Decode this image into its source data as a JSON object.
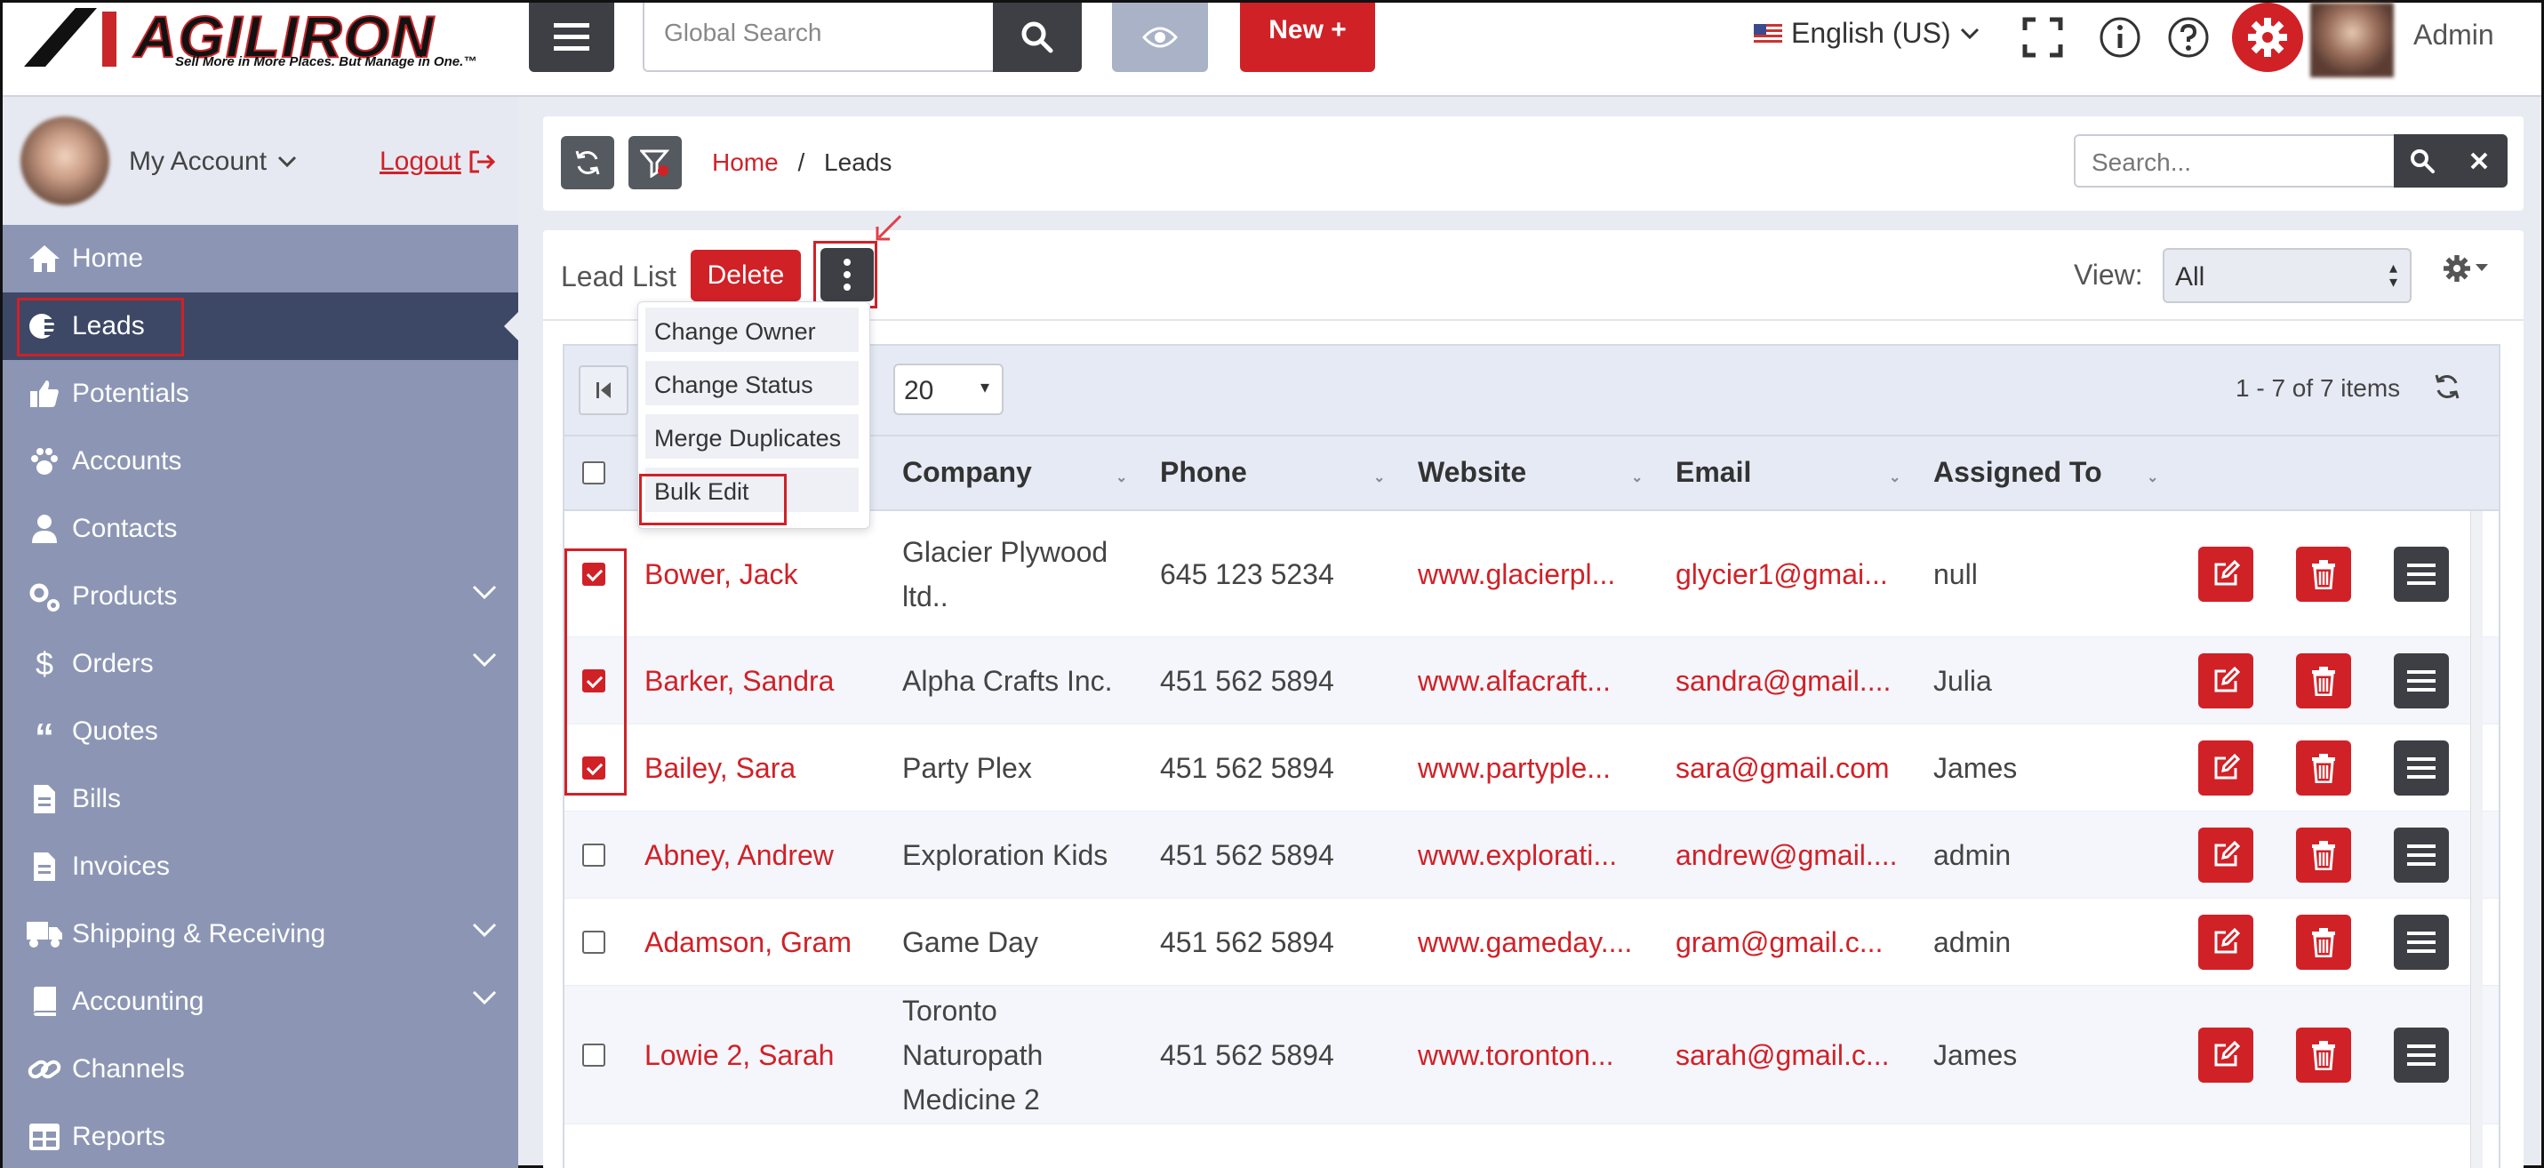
{
  "brand": {
    "name": "AGILIRON",
    "tagline": "Sell More in More Places. But Manage in One.™"
  },
  "topbar": {
    "search_placeholder": "Global Search",
    "new_button": "New +",
    "language": "English (US)",
    "user": "Admin"
  },
  "sidebar": {
    "account_label": "My Account",
    "logout_label": "Logout",
    "items": [
      {
        "label": "Home",
        "icon": "home-icon"
      },
      {
        "label": "Leads",
        "icon": "leads-icon",
        "active": true
      },
      {
        "label": "Potentials",
        "icon": "thumbs-up-icon"
      },
      {
        "label": "Accounts",
        "icon": "paw-icon"
      },
      {
        "label": "Contacts",
        "icon": "user-icon"
      },
      {
        "label": "Products",
        "icon": "gears-icon",
        "expandable": true
      },
      {
        "label": "Orders",
        "icon": "dollar-icon",
        "expandable": true
      },
      {
        "label": "Quotes",
        "icon": "quote-icon"
      },
      {
        "label": "Bills",
        "icon": "file-icon"
      },
      {
        "label": "Invoices",
        "icon": "file-icon"
      },
      {
        "label": "Shipping & Receiving",
        "icon": "truck-icon",
        "expandable": true
      },
      {
        "label": "Accounting",
        "icon": "book-icon",
        "expandable": true
      },
      {
        "label": "Channels",
        "icon": "link-icon"
      },
      {
        "label": "Reports",
        "icon": "table-icon"
      }
    ]
  },
  "breadcrumb": {
    "home": "Home",
    "separator": "/",
    "current": "Leads"
  },
  "list_search_placeholder": "Search...",
  "list": {
    "title": "Lead List",
    "delete_label": "Delete",
    "view_label": "View:",
    "view_value": "All",
    "page_size": "20",
    "items_info": "1 - 7 of 7 items",
    "menu": [
      "Change Owner",
      "Change Status",
      "Merge Duplicates",
      "Bulk Edit"
    ],
    "columns": [
      "Company",
      "Phone",
      "Website",
      "Email",
      "Assigned To"
    ],
    "rows": [
      {
        "name": "Bower, Jack",
        "company": "Glacier Plywood ltd..",
        "phone": "645 123 5234",
        "website": "www.glacierpl...",
        "email": "glycier1@gmai...",
        "assigned": "null",
        "checked": true
      },
      {
        "name": "Barker, Sandra",
        "company": "Alpha Crafts Inc.",
        "phone": "451 562 5894",
        "website": "www.alfacraft...",
        "email": "sandra@gmail....",
        "assigned": "Julia",
        "checked": true
      },
      {
        "name": "Bailey, Sara",
        "company": "Party Plex",
        "phone": "451 562 5894",
        "website": "www.partyple...",
        "email": "sara@gmail.com",
        "assigned": "James",
        "checked": true
      },
      {
        "name": "Abney, Andrew",
        "company": "Exploration Kids",
        "phone": "451 562 5894",
        "website": "www.explorati...",
        "email": "andrew@gmail....",
        "assigned": "admin",
        "checked": false
      },
      {
        "name": "Adamson, Gram",
        "company": "Game Day",
        "phone": "451 562 5894",
        "website": "www.gameday....",
        "email": "gram@gmail.c...",
        "assigned": "admin",
        "checked": false
      },
      {
        "name": "Lowie 2, Sarah",
        "company": "Toronto Naturopath Medicine 2",
        "phone": "451 562 5894",
        "website": "www.toronton...",
        "email": "sarah@gmail.c...",
        "assigned": "James",
        "checked": false
      }
    ]
  },
  "colors": {
    "accent": "#d02127",
    "sidebar": "#8c96b4",
    "sidebar_active": "#3d4866",
    "dark_button": "#3d3f45"
  }
}
